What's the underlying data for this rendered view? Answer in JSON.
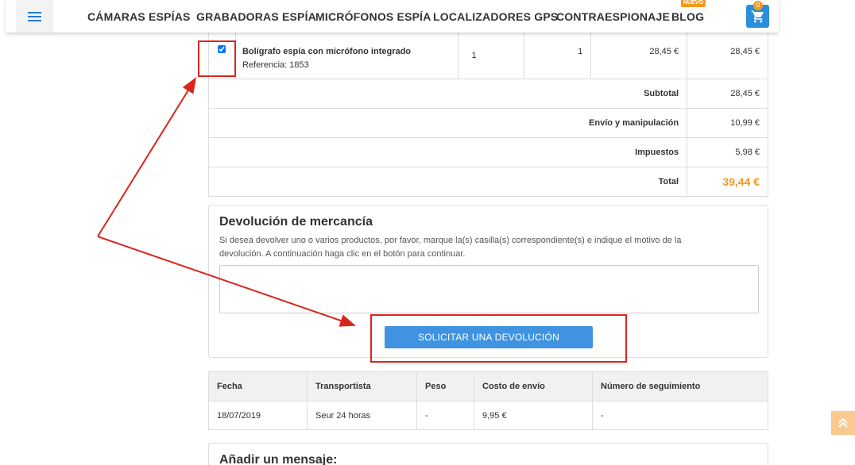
{
  "nav": {
    "items": [
      "CÁMARAS ESPÍAS",
      "GRABADORAS ESPÍA",
      "MICRÓFONOS ESPÍA",
      "LOCALIZADORES GPS",
      "CONTRAESPIONAJE",
      "BLOG"
    ],
    "blog_badge": "NUEVO",
    "cart_count": "0"
  },
  "order": {
    "product_name": "Bolígrafo espía con micrófono integrado",
    "product_ref": "Referencia: 1853",
    "qty": "1",
    "qty_return": "1",
    "unit_price": "28,45 €",
    "line_total": "28,45 €",
    "subtotal_label": "Subtotal",
    "subtotal": "28,45 €",
    "shipping_label": "Envío y manipulación",
    "shipping": "10,99 €",
    "tax_label": "Impuestos",
    "tax": "5,98 €",
    "total_label": "Total",
    "total": "39,44 €"
  },
  "returns": {
    "title": "Devolución de mercancía",
    "instructions": "Si desea devolver uno o varios productos, por favor, marque la(s) casilla(s) correspondiente(s) e indique el motivo de la devolución. A continuación haga clic en el botón para continuar.",
    "textarea_value": "",
    "button_label": "SOLICITAR UNA DEVOLUCIÓN"
  },
  "shipping_table": {
    "headers": [
      "Fecha",
      "Transportista",
      "Peso",
      "Costo de envío",
      "Número de seguimiento"
    ],
    "row": [
      "18/07/2019",
      "Seur 24 horas",
      "-",
      "9,95 €",
      "-"
    ]
  },
  "message": {
    "title": "Añadir un mensaje:"
  },
  "colors": {
    "accent": "#3f93e1",
    "price": "#f29a1d",
    "annotation": "#d9261c"
  }
}
